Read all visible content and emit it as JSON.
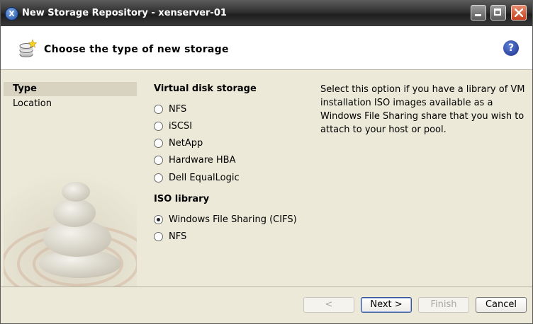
{
  "window": {
    "title": "New Storage Repository - xenserver-01",
    "app_icon_glyph": "X"
  },
  "header": {
    "title": "Choose the type of new storage",
    "help_glyph": "?"
  },
  "nav": {
    "items": [
      {
        "label": "Type"
      },
      {
        "label": "Location"
      }
    ]
  },
  "virtual_disk": {
    "heading": "Virtual disk storage",
    "options": [
      {
        "label": "NFS",
        "checked": false
      },
      {
        "label": "iSCSI",
        "checked": false
      },
      {
        "label": "NetApp",
        "checked": false
      },
      {
        "label": "Hardware HBA",
        "checked": false
      },
      {
        "label": "Dell EqualLogic",
        "checked": false
      }
    ]
  },
  "iso_library": {
    "heading": "ISO library",
    "options": [
      {
        "label": "Windows File Sharing (CIFS)",
        "checked": true
      },
      {
        "label": "NFS",
        "checked": false
      }
    ]
  },
  "description": "Select this option if you have a library of VM installation ISO images available as a Windows File Sharing share that you wish to attach to your host or pool.",
  "footer": {
    "back_label": "<",
    "next_label": "Next >",
    "finish_label": "Finish",
    "cancel_label": "Cancel"
  },
  "colors": {
    "titlebar": "#2f2f2f",
    "dialog_bg": "#ece9d8",
    "selected_nav": "#d8d3c0",
    "close_button": "#c5421f"
  }
}
